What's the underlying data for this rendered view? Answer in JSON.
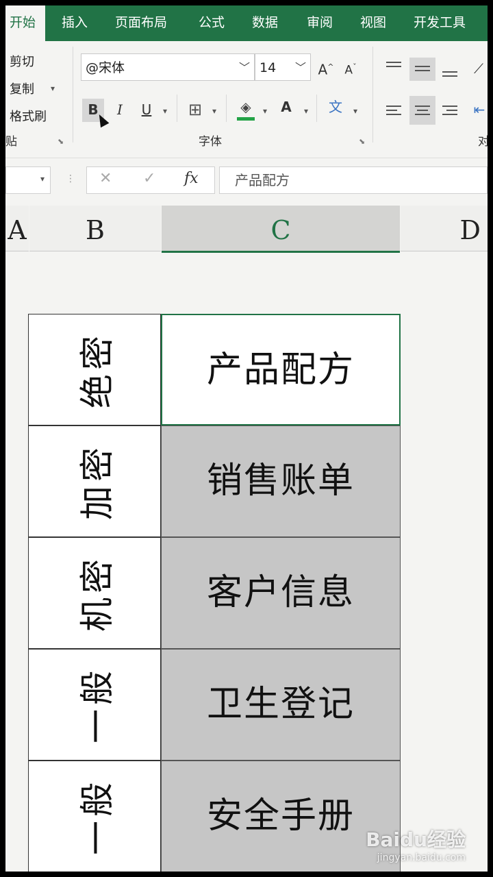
{
  "ribbon": {
    "tabs": [
      "开始",
      "插入",
      "页面布局",
      "公式",
      "数据",
      "审阅",
      "视图",
      "开发工具"
    ],
    "clipboard": {
      "cut": "剪切",
      "copy": "复制",
      "format_painter": "格式刷",
      "group_label": "贴"
    },
    "font": {
      "family": "@宋体",
      "size": "14",
      "grow": "A",
      "shrink": "A",
      "bold": "B",
      "italic": "I",
      "underline": "U",
      "font_color": "A",
      "phonetic": "文",
      "group_label": "字体"
    },
    "align_group_label": "对",
    "accent_color": "#217346"
  },
  "formula_bar": {
    "cancel": "✕",
    "enter": "✓",
    "fx": "fx",
    "content": "产品配方"
  },
  "columns": [
    "A",
    "B",
    "C",
    "D"
  ],
  "selected_column": "C",
  "rows": [
    {
      "level": "绝密",
      "item": "产品配方"
    },
    {
      "level": "加密",
      "item": "销售账单"
    },
    {
      "level": "机密",
      "item": "客户信息"
    },
    {
      "level": "一般",
      "item": "卫生登记"
    },
    {
      "level": "一般",
      "item": "安全手册"
    }
  ],
  "watermark": {
    "brand": "Baidu经验",
    "url": "jingyan.baidu.com"
  }
}
